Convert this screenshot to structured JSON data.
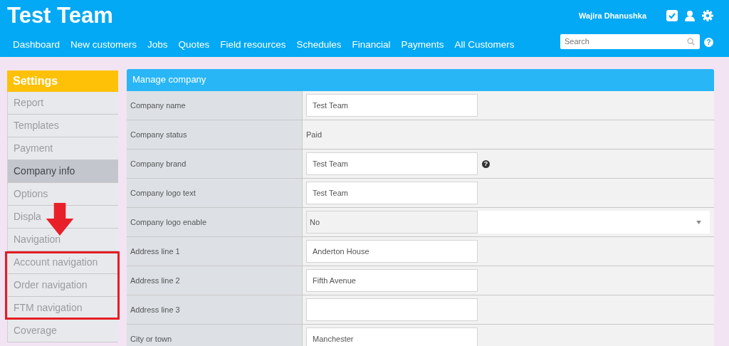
{
  "header": {
    "title": "Test Team",
    "user": "Wajira Dhanushka",
    "nav": [
      "Dashboard",
      "New customers",
      "Jobs",
      "Quotes",
      "Field resources",
      "Schedules",
      "Financial",
      "Payments",
      "All Customers"
    ],
    "search": {
      "placeholder": "Search"
    },
    "help": "?"
  },
  "sidebar": {
    "title": "Settings",
    "items": [
      {
        "label": "Report",
        "selected": false
      },
      {
        "label": "Templates",
        "selected": false
      },
      {
        "label": "Payment",
        "selected": false
      },
      {
        "label": "Company info",
        "selected": true
      },
      {
        "label": "Options",
        "selected": false
      },
      {
        "label": "Displa",
        "selected": false
      },
      {
        "label": "Navigation",
        "selected": false
      },
      {
        "label": "Account navigation",
        "selected": false
      },
      {
        "label": "Order navigation",
        "selected": false
      },
      {
        "label": "FTM navigation",
        "selected": false
      },
      {
        "label": "Coverage",
        "selected": false
      }
    ]
  },
  "panel": {
    "title": "Manage company",
    "rows": [
      {
        "label": "Company name",
        "kind": "input",
        "value": "Test Team"
      },
      {
        "label": "Company status",
        "kind": "text",
        "value": "Paid"
      },
      {
        "label": "Company brand",
        "kind": "help",
        "value": "Test Team",
        "help": "?"
      },
      {
        "label": "Company logo text",
        "kind": "input",
        "value": "Test Team"
      },
      {
        "label": "Company logo enable",
        "kind": "select",
        "value": "No"
      },
      {
        "label": "Address line 1",
        "kind": "input",
        "value": "Anderton House"
      },
      {
        "label": "Address line 2",
        "kind": "input",
        "value": "Fifth Avenue"
      },
      {
        "label": "Address line 3",
        "kind": "input",
        "value": ""
      },
      {
        "label": "City or town",
        "kind": "input",
        "value": "Manchester"
      }
    ]
  }
}
